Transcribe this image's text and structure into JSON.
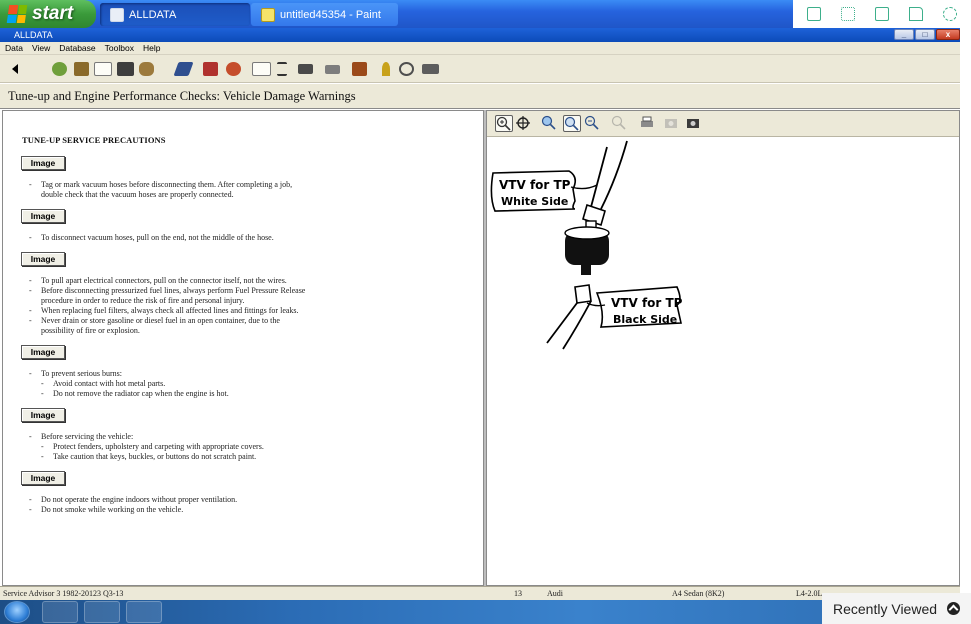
{
  "taskbar": {
    "start_label": "start",
    "tasks": [
      {
        "label": "ALLDATA",
        "active": true
      },
      {
        "label": "untitled45354 - Paint",
        "active": false
      }
    ]
  },
  "window": {
    "title": "ALLDATA",
    "controls": [
      "_",
      "□",
      "x"
    ]
  },
  "menu": [
    "Data",
    "View",
    "Database",
    "Toolbox",
    "Help"
  ],
  "document": {
    "title": "Tune-up and Engine Performance Checks:  Vehicle Damage Warnings"
  },
  "content": {
    "heading": "TUNE-UP SERVICE PRECAUTIONS",
    "image_button_label": "Image",
    "blocks": [
      {
        "lines": [
          {
            "text": "Tag or mark vacuum hoses before disconnecting them. After completing a job,",
            "dash": true
          },
          {
            "text": "double check that the vacuum hoses are properly connected.",
            "dash": false
          }
        ]
      },
      {
        "lines": [
          {
            "text": "To disconnect vacuum hoses, pull on the end, not the middle of the hose.",
            "dash": true
          }
        ]
      },
      {
        "lines": [
          {
            "text": "To pull apart electrical connectors, pull on the connector itself, not the wires.",
            "dash": true
          },
          {
            "text": "Before disconnecting pressurized fuel lines, always perform Fuel Pressure Release",
            "dash": true
          },
          {
            "text": "procedure in order to reduce the risk of fire and personal injury.",
            "dash": false
          },
          {
            "text": "When replacing fuel filters, always check all affected lines and fittings for leaks.",
            "dash": true
          },
          {
            "text": "Never drain or store gasoline or diesel fuel in an open container, due to the",
            "dash": true
          },
          {
            "text": "possibility of fire or explosion.",
            "dash": false
          }
        ]
      },
      {
        "lines": [
          {
            "text": "To prevent serious burns:",
            "dash": true
          },
          {
            "text": "Avoid contact with hot metal parts.",
            "dash": true,
            "sub": true
          },
          {
            "text": "Do not remove the radiator cap when the engine is hot.",
            "dash": true,
            "sub": true
          }
        ]
      },
      {
        "lines": [
          {
            "text": "Before servicing the vehicle:",
            "dash": true
          },
          {
            "text": "Protect fenders, upholstery and carpeting with appropriate covers.",
            "dash": true,
            "sub": true
          },
          {
            "text": "Take caution that keys, buckles, or buttons do not scratch paint.",
            "dash": true,
            "sub": true
          }
        ]
      },
      {
        "lines": [
          {
            "text": "Do not operate the engine indoors without proper ventilation.",
            "dash": true
          },
          {
            "text": "Do not smoke while working on the vehicle.",
            "dash": true
          }
        ]
      }
    ]
  },
  "diagram": {
    "label_top_line1": "VTV for TP",
    "label_top_line2": "White Side",
    "label_bottom_line1": "VTV for TP",
    "label_bottom_line2": "Black Side"
  },
  "status": {
    "product": "Service Advisor 3 1982-20123 Q3-13",
    "field_num": "13",
    "make": "Audi",
    "model": "A4 Sedan (8K2)",
    "engine": "L4-2.0L"
  },
  "overlay": {
    "recently_viewed": "Recently Viewed"
  },
  "dash_char": "-"
}
